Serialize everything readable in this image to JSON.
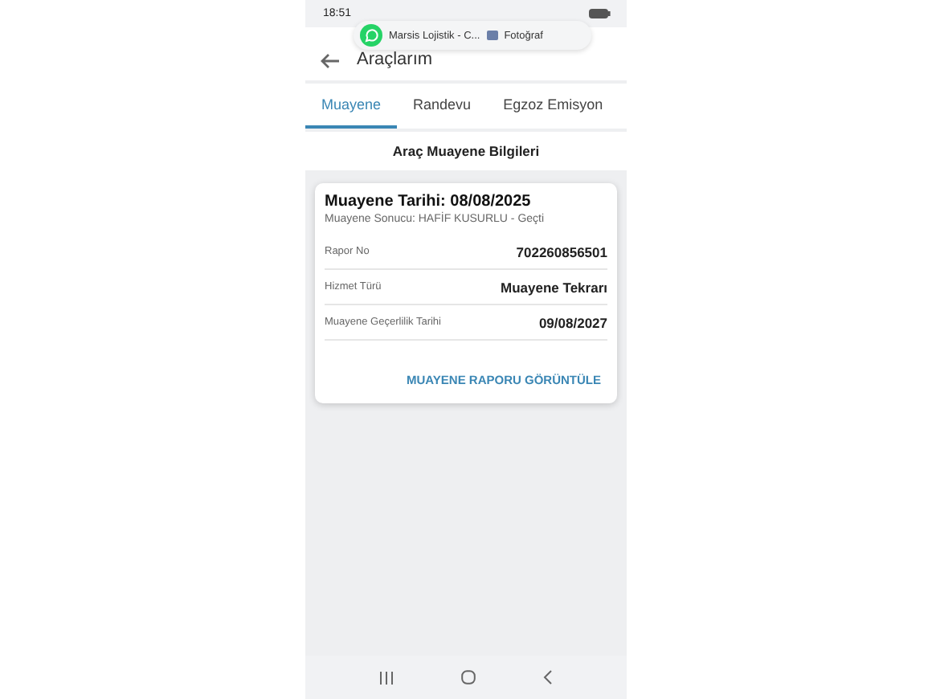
{
  "status_bar": {
    "time": "18:51"
  },
  "notification": {
    "title": "Marsis Lojistik - C...",
    "attachment": "Fotoğraf"
  },
  "header": {
    "title": "Araçlarım"
  },
  "tabs": [
    {
      "label": "Muayene",
      "selected": true
    },
    {
      "label": "Randevu",
      "selected": false
    },
    {
      "label": "Egzoz Emisyon",
      "selected": false
    }
  ],
  "section_title": "Araç Muayene Bilgileri",
  "card": {
    "title": "Muayene Tarihi: 08/08/2025",
    "subtitle": "Muayene Sonucu: HAFİF KUSURLU - Geçti",
    "rows": [
      {
        "label": "Rapor No",
        "value": "702260856501"
      },
      {
        "label": "Hizmet Türü",
        "value": "Muayene Tekrarı"
      },
      {
        "label": "Muayene Geçerlilik Tarihi",
        "value": "09/08/2027"
      }
    ],
    "action": "MUAYENE RAPORU GÖRÜNTÜLE"
  }
}
